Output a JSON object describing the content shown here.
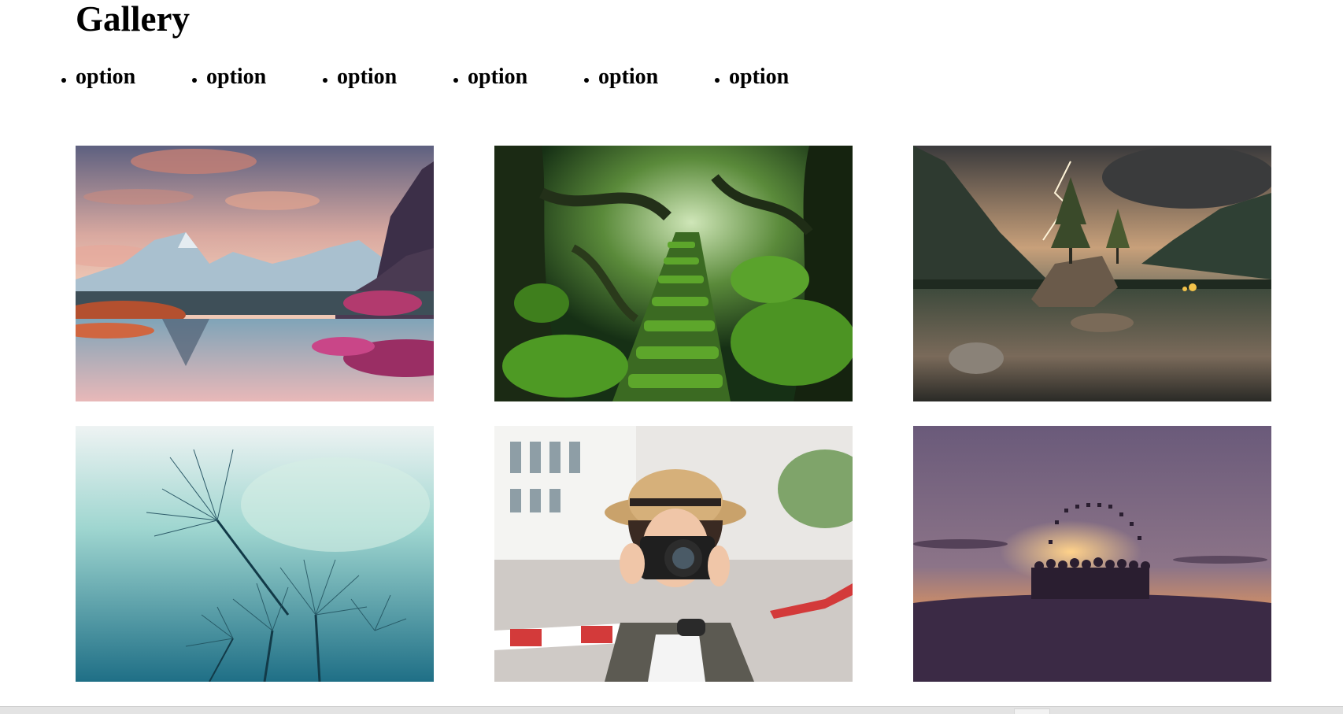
{
  "page": {
    "title": "Gallery"
  },
  "nav": {
    "items": [
      {
        "label": "option"
      },
      {
        "label": "option"
      },
      {
        "label": "option"
      },
      {
        "label": "option"
      },
      {
        "label": "option"
      },
      {
        "label": "option"
      }
    ]
  },
  "gallery": {
    "images": [
      {
        "subject": "mountain-lake-sunset-photo"
      },
      {
        "subject": "mossy-forest-stairs-photo"
      },
      {
        "subject": "lake-island-lightning-photo"
      },
      {
        "subject": "dandelion-seeds-photo"
      },
      {
        "subject": "woman-with-camera-photo"
      },
      {
        "subject": "graduates-hat-toss-silhouette-photo"
      }
    ]
  }
}
